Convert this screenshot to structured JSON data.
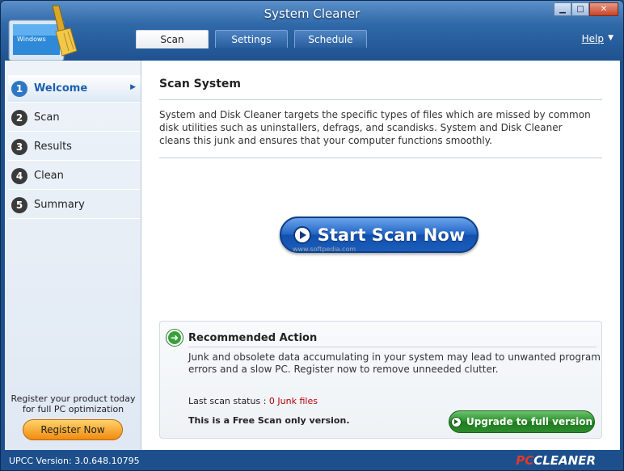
{
  "window": {
    "title": "System Cleaner",
    "controls": {
      "minimize": "▁",
      "maximize": "□",
      "close": "✕"
    }
  },
  "logo": {
    "icon": "windows-vista-monitor-with-broom",
    "screen_text": "Windows"
  },
  "tabs": [
    {
      "label": "Scan",
      "active": true
    },
    {
      "label": "Settings",
      "active": false
    },
    {
      "label": "Schedule",
      "active": false
    }
  ],
  "help": {
    "label": "Help",
    "arrow": "▼"
  },
  "sidebar": {
    "items": [
      {
        "num": "1",
        "label": "Welcome",
        "active": true
      },
      {
        "num": "2",
        "label": "Scan",
        "active": false
      },
      {
        "num": "3",
        "label": "Results",
        "active": false
      },
      {
        "num": "4",
        "label": "Clean",
        "active": false
      },
      {
        "num": "5",
        "label": "Summary",
        "active": false
      }
    ],
    "active_arrow": "▶",
    "register_text_1": "Register your product today",
    "register_text_2": "for full PC optimization",
    "register_button": "Register Now"
  },
  "main": {
    "title": "Scan System",
    "description": "System and Disk Cleaner targets the specific types of files which are missed by common disk utilities such as uninstallers, defrags, and scandisks. System and Disk Cleaner cleans this junk and ensures that your computer functions smoothly.",
    "scan_button": "Start Scan Now",
    "watermark": "www.softpedia.com"
  },
  "recommendation": {
    "title": "Recommended Action",
    "icon_glyph": "➜",
    "text": "Junk and obsolete data accumulating in your system may lead to unwanted program errors and a slow PC. Register now to remove unneeded clutter.",
    "last_scan_label": "Last scan status : ",
    "last_scan_value": "0 Junk files",
    "free_note": "This is a Free Scan only version.",
    "upgrade_button": "Upgrade to full version"
  },
  "statusbar": {
    "version": "UPCC Version: 3.0.648.10795",
    "brand_pc": "PC",
    "brand_name": "CLEANER"
  },
  "colors": {
    "frame": "#1d4f8c",
    "accent_blue": "#2366c6",
    "accent_green": "#2e8f2e",
    "accent_orange": "#f08a10",
    "status_red": "#b40000"
  }
}
